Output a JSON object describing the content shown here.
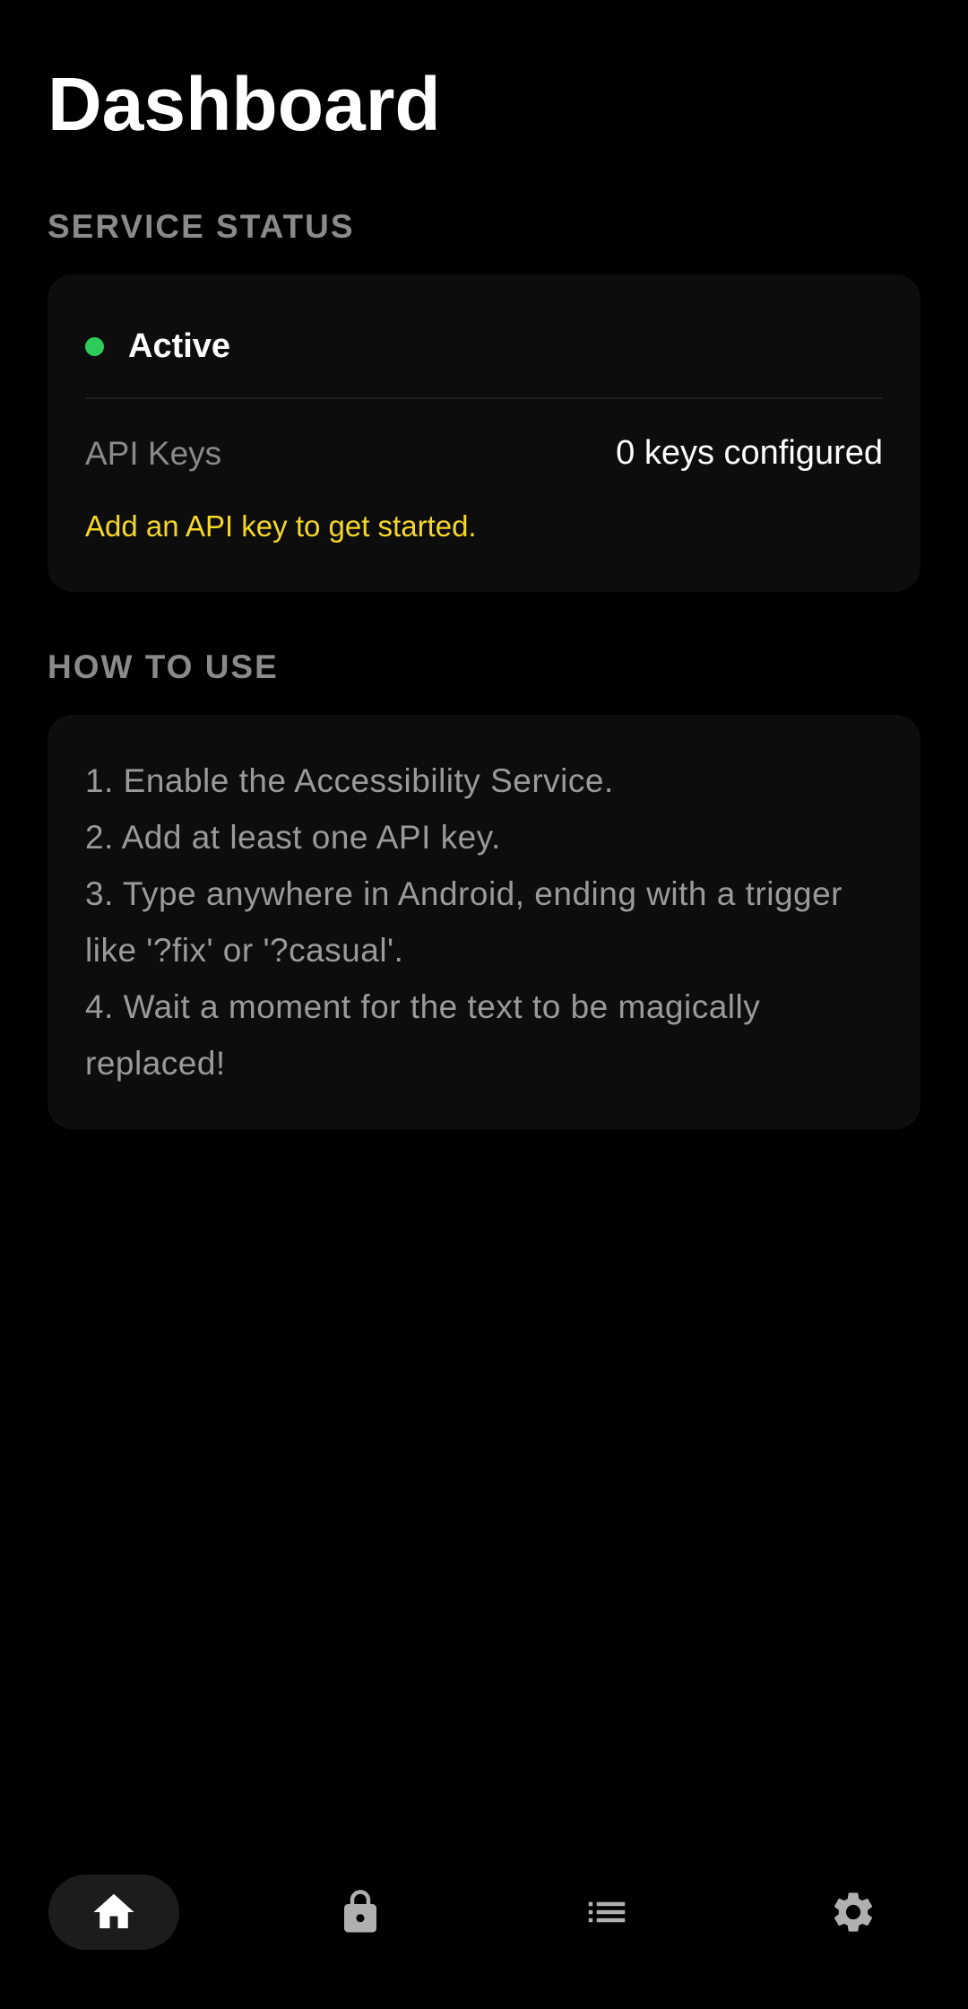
{
  "header": {
    "title": "Dashboard"
  },
  "service_status": {
    "section_label": "SERVICE STATUS",
    "status": "Active",
    "status_color": "#2ecc5a",
    "api_keys_label": "API Keys",
    "api_keys_value": "0 keys configured",
    "hint": "Add an API key to get started.",
    "hint_color": "#f5d62a"
  },
  "how_to_use": {
    "section_label": "HOW TO USE",
    "steps": [
      "1. Enable the Accessibility Service.",
      "2. Add at least one API key.",
      "3. Type anywhere in Android, ending with a trigger like '?fix' or '?casual'.",
      "4. Wait a moment for the text to be magically replaced!"
    ]
  },
  "bottom_nav": {
    "items": [
      {
        "icon": "home-icon",
        "active": true
      },
      {
        "icon": "lock-icon",
        "active": false
      },
      {
        "icon": "list-icon",
        "active": false
      },
      {
        "icon": "gear-icon",
        "active": false
      }
    ]
  }
}
